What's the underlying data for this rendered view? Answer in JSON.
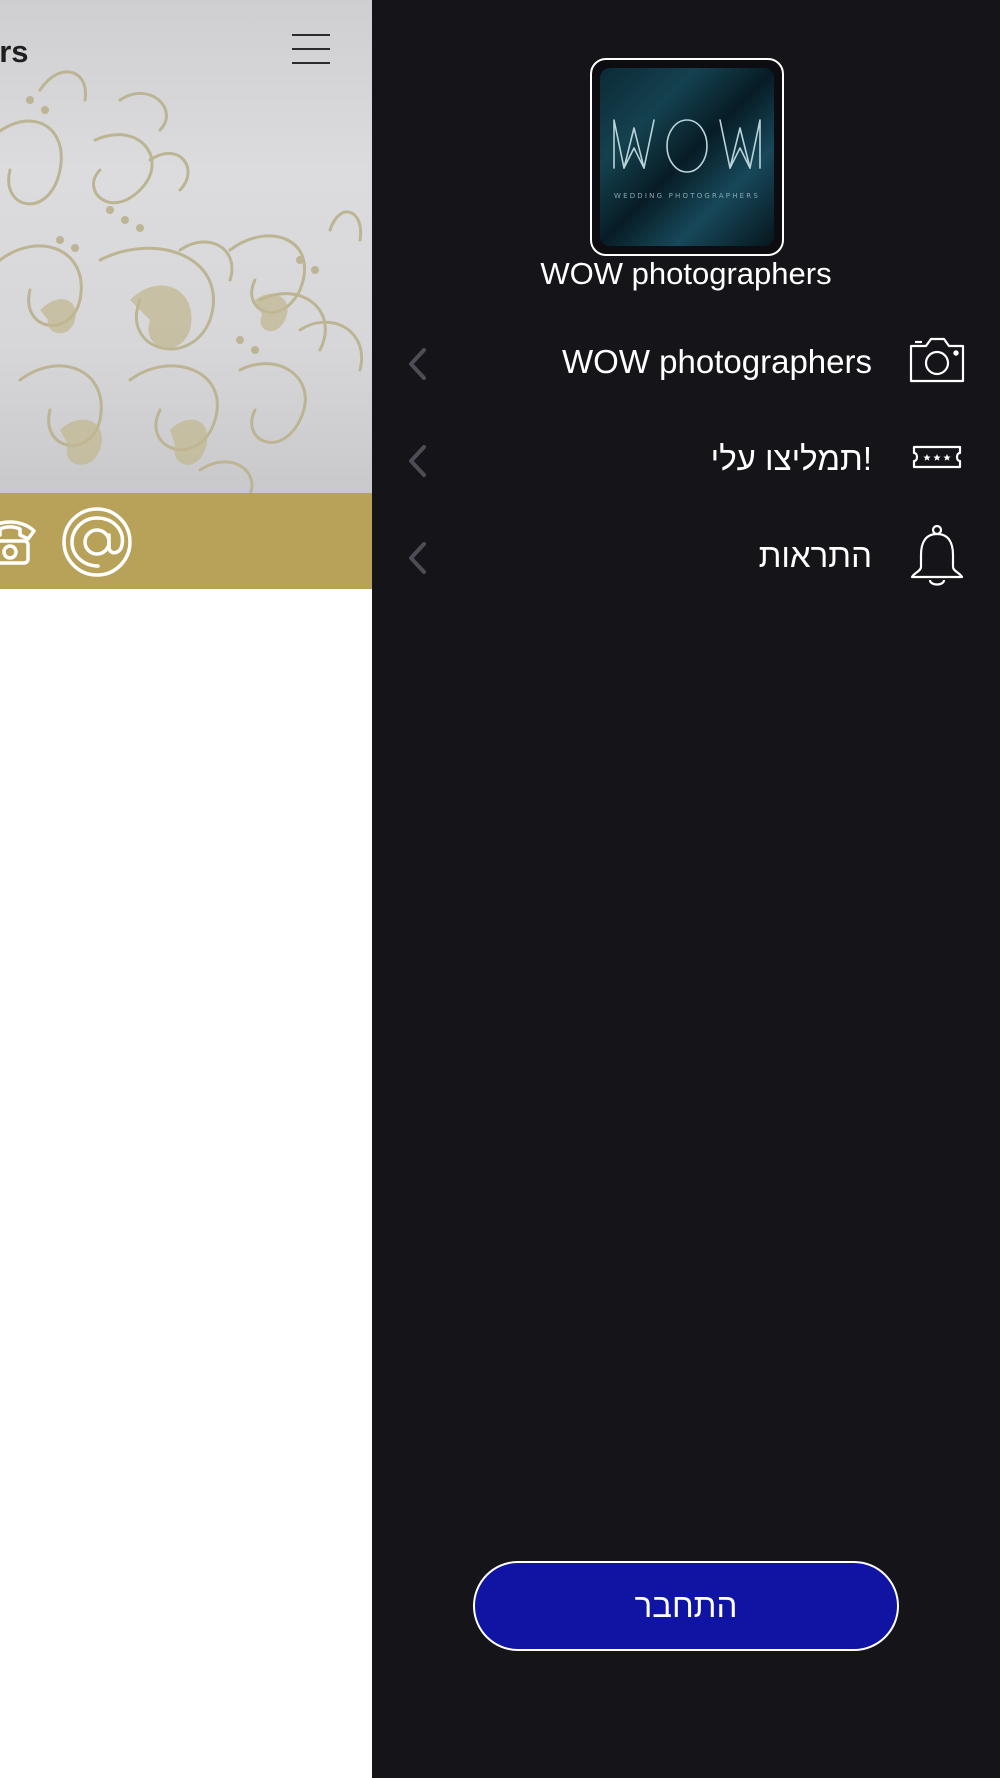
{
  "background_page": {
    "title_fragment": "ers",
    "menu_icon": "hamburger-menu-icon",
    "contact_bar": {
      "color": "#b8a25a",
      "icons": [
        "phone-icon",
        "at-email-icon"
      ]
    }
  },
  "drawer": {
    "background": "#141419",
    "logo": {
      "text": "WOW",
      "subtitle": "WEDDING PHOTOGRAPHERS"
    },
    "app_name": "WOW photographers",
    "menu_items": [
      {
        "label": "WOW photographers",
        "icon": "camera-icon"
      },
      {
        "label": "תמליצו עלי!",
        "icon": "ticket-rating-icon"
      },
      {
        "label": "התראות",
        "icon": "bell-icon"
      }
    ],
    "login_button": {
      "label": "התחבר",
      "color": "#0f14a3"
    }
  }
}
